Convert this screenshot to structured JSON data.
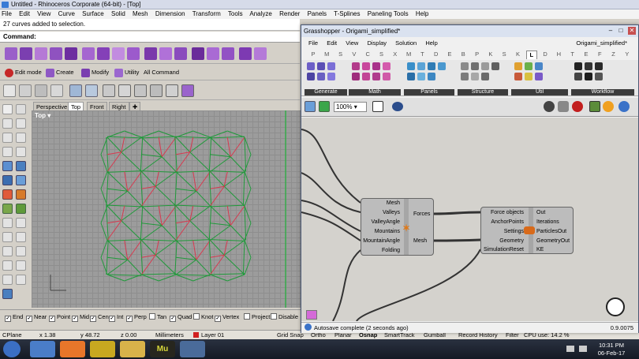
{
  "rhino": {
    "title": "Untitled - Rhinoceros Corporate (64-bit) - [Top]",
    "menu": [
      "File",
      "Edit",
      "View",
      "Curve",
      "Surface",
      "Solid",
      "Mesh",
      "Dimension",
      "Transform",
      "Tools",
      "Analyze",
      "Render",
      "Panels",
      "T-Splines",
      "Paneling Tools",
      "Help"
    ],
    "command_history": "27 curves added to selection.",
    "command_prompt": "Command:",
    "tabs2": [
      "Edit mode",
      "Create",
      "Modify",
      "Utility",
      "All Command"
    ],
    "viewport_tabs": [
      "Perspective",
      "Top",
      "Front",
      "Right"
    ],
    "active_view": "Top",
    "viewport_label": "Top",
    "osnaps": [
      {
        "label": "End",
        "checked": true
      },
      {
        "label": "Near",
        "checked": true
      },
      {
        "label": "Point",
        "checked": true
      },
      {
        "label": "Mid",
        "checked": true
      },
      {
        "label": "Cen",
        "checked": true
      },
      {
        "label": "Int",
        "checked": true
      },
      {
        "label": "Perp",
        "checked": true
      },
      {
        "label": "Tan",
        "checked": false
      },
      {
        "label": "Quad",
        "checked": true
      },
      {
        "label": "Knot",
        "checked": false
      },
      {
        "label": "Vertex",
        "checked": true
      },
      {
        "label": "Project",
        "checked": false
      },
      {
        "label": "Disable",
        "checked": false
      }
    ],
    "status": {
      "cplane": "CPlane",
      "x": "x 1.38",
      "y": "y 48.72",
      "z": "z 0.00",
      "units": "Millimeters",
      "layer": "Layer 01",
      "layer_color": "#d12020",
      "toggles": [
        "Grid Snap",
        "Ortho",
        "Planar",
        "Osnap",
        "SmartTrack",
        "Gumball",
        "Record History",
        "Filter",
        "CPU use: 14.2 %"
      ]
    }
  },
  "grasshopper": {
    "title": "Grasshopper - Origami_simplified*",
    "menu": [
      "File",
      "Edit",
      "View",
      "Display",
      "Solution",
      "Help"
    ],
    "filename": "Origami_simplified*",
    "letter_tabs": [
      "P",
      "M",
      "S",
      "V",
      "C",
      "S",
      "X",
      "M",
      "T",
      "D",
      "E",
      "B",
      "P",
      "K",
      "S",
      "K",
      "L",
      "D",
      "H",
      "T",
      "E",
      "F",
      "Z",
      "Y"
    ],
    "active_letter_index": 16,
    "panel_groups": [
      "Generate",
      "Math",
      "Panels",
      "Structure",
      "Util",
      "Workflow"
    ],
    "zoom": "100%",
    "component_origami": {
      "inputs": [
        "Mesh",
        "Valleys",
        "ValleyAngle",
        "Mountains",
        "MountainAngle",
        "Folding"
      ],
      "outputs": [
        "Forces",
        "Mesh"
      ]
    },
    "component_kangaroo": {
      "inputs": [
        "Force objects",
        "AnchorPoints",
        "Settings",
        "Geometry",
        "SimulationReset"
      ],
      "outputs": [
        "Out",
        "Iterations",
        "ParticlesOut",
        "GeometryOut",
        "KE"
      ]
    },
    "status_text": "Autosave complete (2 seconds ago)",
    "version": "0.9.0075"
  },
  "taskbar": {
    "time": "10:31 PM",
    "date": "06-Feb-17",
    "apps": [
      "rhino",
      "firefox",
      "chrome",
      "explorer",
      "muse",
      "rhino-alt"
    ]
  },
  "colors": {
    "fold_green": "#1f9a3a",
    "fold_red": "#d8394f",
    "axis_green": "#20b33a",
    "gh_canvas": "#d4d2cd"
  }
}
